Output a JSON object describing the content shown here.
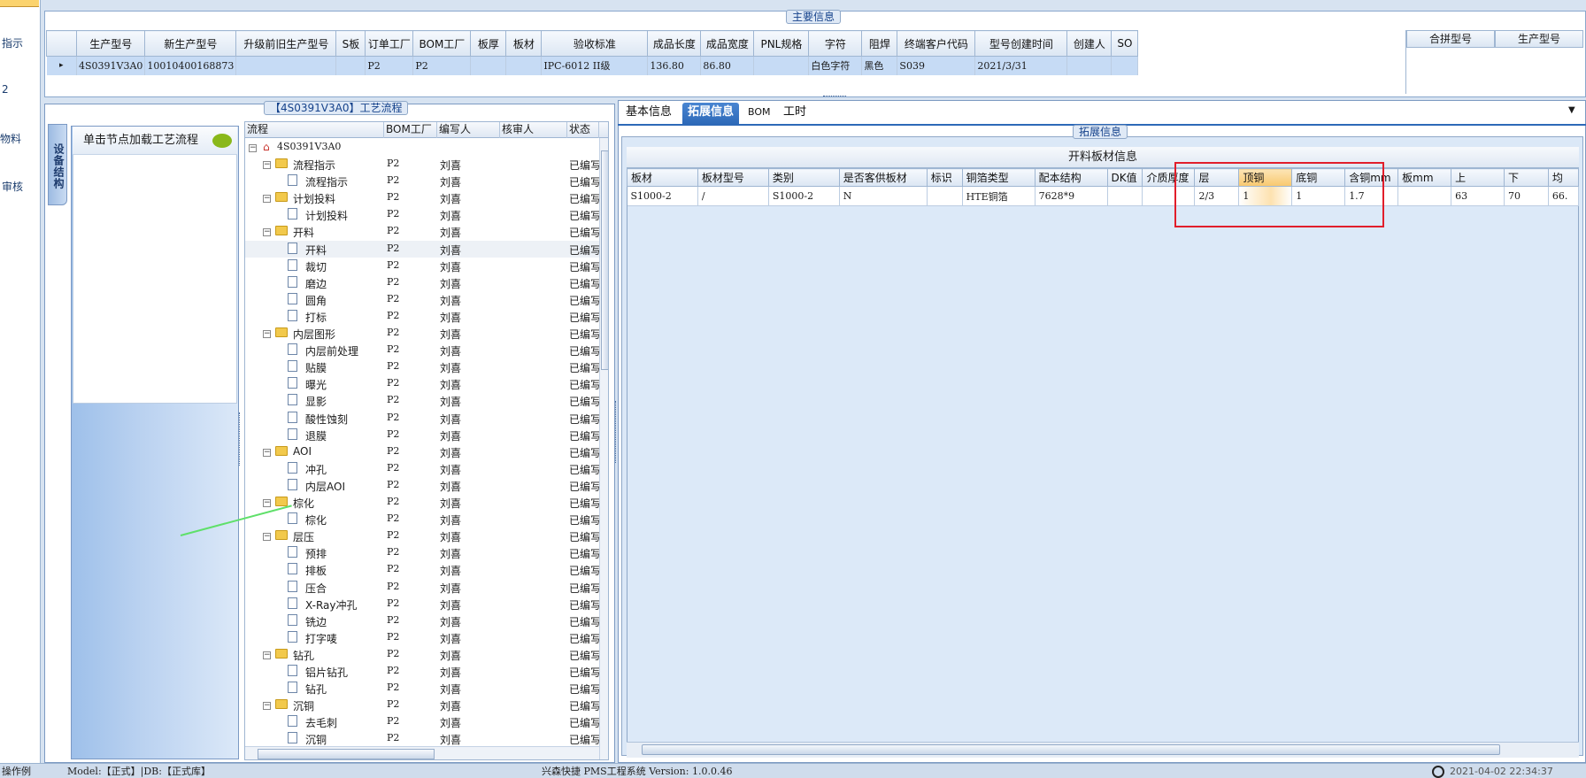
{
  "left_nav": {
    "items": [
      "指示",
      "2",
      "物料",
      "审核"
    ]
  },
  "main_info": {
    "title": "主要信息",
    "columns": [
      "生产型号",
      "新生产型号",
      "升级前旧生产型号",
      "S板",
      "订单工厂",
      "BOM工厂",
      "板厚",
      "板材",
      "验收标准",
      "成品长度",
      "成品宽度",
      "PNL规格",
      "字符",
      "阻焊",
      "终端客户代码",
      "型号创建时间",
      "创建人",
      "SO"
    ],
    "row": [
      "4S0391V3A0",
      "10010400168873",
      "",
      "",
      "P2",
      "P2",
      "",
      "",
      "IPC-6012 II级",
      "136.80",
      "86.80",
      "",
      "白色字符",
      "黑色",
      "S039",
      "2021/3/31",
      "",
      ""
    ],
    "right_columns": [
      "合拼型号",
      "生产型号"
    ]
  },
  "process": {
    "title": "【4S0391V3A0】工艺流程",
    "side_tab": "设备结构",
    "load_hint": "单击节点加载工艺流程",
    "tree_columns": [
      "流程",
      "BOM工厂",
      "编写人",
      "核审人",
      "状态"
    ],
    "root": "4S0391V3A0",
    "rows": [
      {
        "name": "流程指示",
        "level": 1,
        "type": "folder",
        "factory": "P2",
        "writer": "刘喜",
        "status": "已编写"
      },
      {
        "name": "流程指示",
        "level": 2,
        "type": "doc",
        "factory": "P2",
        "writer": "刘喜",
        "status": "已编写"
      },
      {
        "name": "计划投料",
        "level": 1,
        "type": "folder",
        "factory": "P2",
        "writer": "刘喜",
        "status": "已编写"
      },
      {
        "name": "计划投料",
        "level": 2,
        "type": "doc",
        "factory": "P2",
        "writer": "刘喜",
        "status": "已编写"
      },
      {
        "name": "开料",
        "level": 1,
        "type": "folder",
        "factory": "P2",
        "writer": "刘喜",
        "status": "已编写"
      },
      {
        "name": "开料",
        "level": 2,
        "type": "doc",
        "factory": "P2",
        "writer": "刘喜",
        "status": "已编写",
        "selected": true
      },
      {
        "name": "裁切",
        "level": 2,
        "type": "doc",
        "factory": "P2",
        "writer": "刘喜",
        "status": "已编写"
      },
      {
        "name": "磨边",
        "level": 2,
        "type": "doc",
        "factory": "P2",
        "writer": "刘喜",
        "status": "已编写"
      },
      {
        "name": "圆角",
        "level": 2,
        "type": "doc",
        "factory": "P2",
        "writer": "刘喜",
        "status": "已编写"
      },
      {
        "name": "打标",
        "level": 2,
        "type": "doc",
        "factory": "P2",
        "writer": "刘喜",
        "status": "已编写"
      },
      {
        "name": "内层图形",
        "level": 1,
        "type": "folder",
        "factory": "P2",
        "writer": "刘喜",
        "status": "已编写"
      },
      {
        "name": "内层前处理",
        "level": 2,
        "type": "doc",
        "factory": "P2",
        "writer": "刘喜",
        "status": "已编写"
      },
      {
        "name": "贴膜",
        "level": 2,
        "type": "doc",
        "factory": "P2",
        "writer": "刘喜",
        "status": "已编写"
      },
      {
        "name": "曝光",
        "level": 2,
        "type": "doc",
        "factory": "P2",
        "writer": "刘喜",
        "status": "已编写"
      },
      {
        "name": "显影",
        "level": 2,
        "type": "doc",
        "factory": "P2",
        "writer": "刘喜",
        "status": "已编写"
      },
      {
        "name": "酸性蚀刻",
        "level": 2,
        "type": "doc",
        "factory": "P2",
        "writer": "刘喜",
        "status": "已编写"
      },
      {
        "name": "退膜",
        "level": 2,
        "type": "doc",
        "factory": "P2",
        "writer": "刘喜",
        "status": "已编写"
      },
      {
        "name": "AOI",
        "level": 1,
        "type": "folder",
        "factory": "P2",
        "writer": "刘喜",
        "status": "已编写"
      },
      {
        "name": "冲孔",
        "level": 2,
        "type": "doc",
        "factory": "P2",
        "writer": "刘喜",
        "status": "已编写"
      },
      {
        "name": "内层AOI",
        "level": 2,
        "type": "doc",
        "factory": "P2",
        "writer": "刘喜",
        "status": "已编写"
      },
      {
        "name": "棕化",
        "level": 1,
        "type": "folder",
        "factory": "P2",
        "writer": "刘喜",
        "status": "已编写"
      },
      {
        "name": "棕化",
        "level": 2,
        "type": "doc",
        "factory": "P2",
        "writer": "刘喜",
        "status": "已编写"
      },
      {
        "name": "层压",
        "level": 1,
        "type": "folder",
        "factory": "P2",
        "writer": "刘喜",
        "status": "已编写"
      },
      {
        "name": "预排",
        "level": 2,
        "type": "doc",
        "factory": "P2",
        "writer": "刘喜",
        "status": "已编写"
      },
      {
        "name": "排板",
        "level": 2,
        "type": "doc",
        "factory": "P2",
        "writer": "刘喜",
        "status": "已编写"
      },
      {
        "name": "压合",
        "level": 2,
        "type": "doc",
        "factory": "P2",
        "writer": "刘喜",
        "status": "已编写"
      },
      {
        "name": "X-Ray冲孔",
        "level": 2,
        "type": "doc",
        "factory": "P2",
        "writer": "刘喜",
        "status": "已编写"
      },
      {
        "name": "铣边",
        "level": 2,
        "type": "doc",
        "factory": "P2",
        "writer": "刘喜",
        "status": "已编写"
      },
      {
        "name": "打字唛",
        "level": 2,
        "type": "doc",
        "factory": "P2",
        "writer": "刘喜",
        "status": "已编写"
      },
      {
        "name": "钻孔",
        "level": 1,
        "type": "folder",
        "factory": "P2",
        "writer": "刘喜",
        "status": "已编写"
      },
      {
        "name": "铝片钻孔",
        "level": 2,
        "type": "doc",
        "factory": "P2",
        "writer": "刘喜",
        "status": "已编写"
      },
      {
        "name": "钻孔",
        "level": 2,
        "type": "doc",
        "factory": "P2",
        "writer": "刘喜",
        "status": "已编写"
      },
      {
        "name": "沉铜",
        "level": 1,
        "type": "folder",
        "factory": "P2",
        "writer": "刘喜",
        "status": "已编写"
      },
      {
        "name": "去毛刺",
        "level": 2,
        "type": "doc",
        "factory": "P2",
        "writer": "刘喜",
        "status": "已编写"
      },
      {
        "name": "沉铜",
        "level": 2,
        "type": "doc",
        "factory": "P2",
        "writer": "刘喜",
        "status": "已编写"
      }
    ]
  },
  "ext": {
    "tabs": [
      "基本信息",
      "拓展信息",
      "BOM",
      "工时"
    ],
    "active_tab": "拓展信息",
    "group_title": "拓展信息",
    "table_title": "开料板材信息",
    "columns": [
      "板材",
      "板材型号",
      "类别",
      "是否客供板材",
      "标识",
      "铜箔类型",
      "配本结构",
      "DK值",
      "介质厚度",
      "层",
      "顶铜",
      "底铜",
      "含铜mm",
      "板mm",
      "上",
      "下",
      "均"
    ],
    "row": [
      "S1000-2",
      "/",
      "S1000-2",
      "N",
      "",
      "HTE铜箔",
      "7628*9",
      "",
      "",
      "2/3",
      "1",
      "1",
      "1.7",
      "",
      "63",
      "70",
      "66."
    ]
  },
  "status": {
    "left": "操作例",
    "mid": "Model:【正式】|DB:【正式库】",
    "center": "兴森快捷 PMS工程系统 Version: 1.0.0.46",
    "time": "2021-04-02 22:34:37"
  },
  "colors": {
    "accent": "#2d69b8",
    "highlight_box": "#e11e2b",
    "selected_row": "#c6dbf5"
  }
}
